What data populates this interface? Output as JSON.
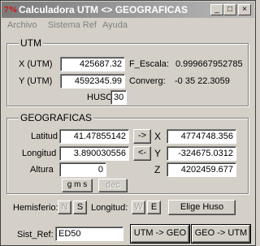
{
  "window": {
    "title": "Calculadora UTM <> GEOGRAFICAS",
    "icon": "7%",
    "controls": {
      "minimize": "_",
      "maximize": "□",
      "close": "×"
    }
  },
  "menu": [
    "Archivo",
    "Sistema Ref",
    "Ayuda"
  ],
  "utm": {
    "group_label": "UTM",
    "x_label": "X (UTM)",
    "x_value": "425687.32",
    "y_label": "Y (UTM)",
    "y_value": "4592345.99",
    "huso_label": "HUSO:",
    "huso_value": "30",
    "f_escala_label": "F_Escala:",
    "f_escala_value": "0.999667952785",
    "converg_label": "Converg:",
    "converg_value": "-0  35  22.3059"
  },
  "geo": {
    "group_label": "GEOGRAFICAS",
    "latitud_label": "Latitud",
    "latitud_value": "41.47855142",
    "longitud_label": "Longitud",
    "longitud_value": "3.890030556",
    "altura_label": "Altura",
    "altura_value": "0",
    "to_cart_label": "->",
    "from_cart_label": "<-",
    "x_label": "X",
    "x_value": "4774748.356",
    "y_label": "Y",
    "y_value": "-324675.0312",
    "z_label": "Z",
    "z_value": "4202459.677",
    "gms_label": "g m s",
    "dec_label": "dec"
  },
  "hemisphere": {
    "hemisferio_label": "Hemisferio:",
    "n_label": "N",
    "s_label": "S",
    "longitud_label": "Longitud:",
    "w_label": "W",
    "e_label": "E",
    "elige_huso_label": "Elige Huso"
  },
  "footer": {
    "sist_ref_label": "Sist_Ref:",
    "sist_ref_value": "ED50",
    "utm_geo_label": "UTM -> GEO",
    "geo_utm_label": "GEO -> UTM"
  }
}
